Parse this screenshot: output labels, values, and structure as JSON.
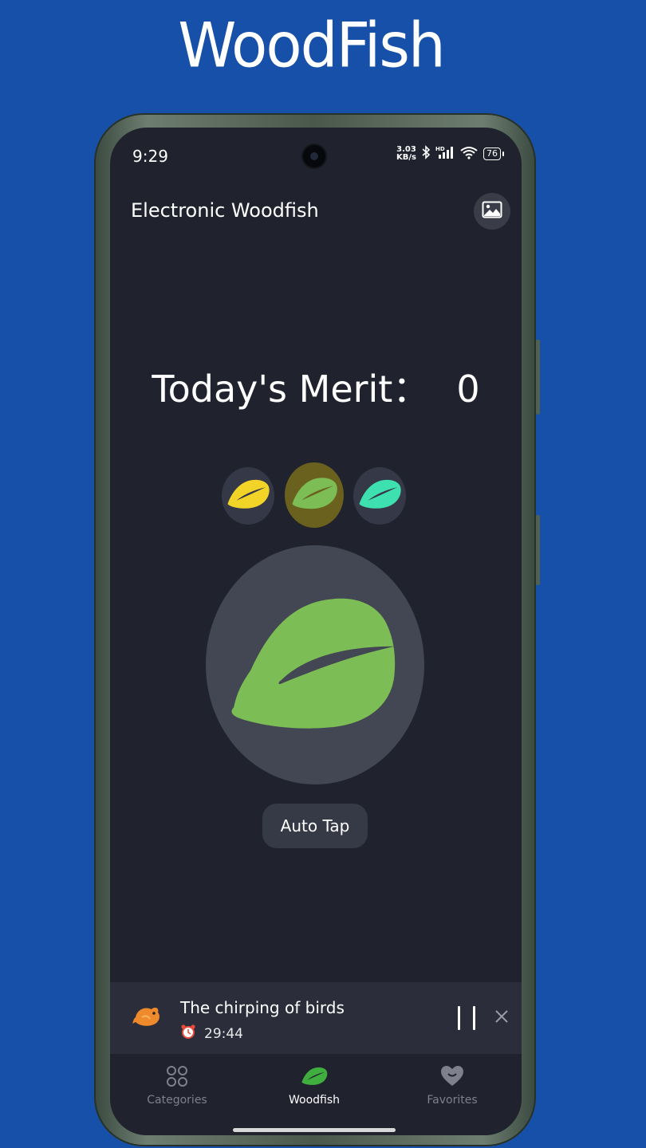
{
  "promo": {
    "title": "WoodFish"
  },
  "status_bar": {
    "time": "9:29",
    "net_speed_value": "3.03",
    "net_speed_unit": "KB/s",
    "hd_label": "HD",
    "battery": "76"
  },
  "header": {
    "title": "Electronic Woodfish"
  },
  "merit": {
    "label": "Today's Merit：",
    "value": "0"
  },
  "woodfish_picker": {
    "options": [
      {
        "color": "#f2d429"
      },
      {
        "color": "#7cbd55",
        "selected": true
      },
      {
        "color": "#3ee0b0"
      }
    ]
  },
  "main_woodfish": {
    "color": "#7cbd55"
  },
  "auto_tap": {
    "label": "Auto Tap"
  },
  "player": {
    "title": "The chirping of birds",
    "timer": "29:44"
  },
  "bottom_nav": {
    "items": [
      {
        "label": "Categories",
        "icon": "categories-icon"
      },
      {
        "label": "Woodfish",
        "icon": "woodfish-icon",
        "active": true
      },
      {
        "label": "Favorites",
        "icon": "heart-icon"
      }
    ]
  },
  "colors": {
    "background": "#1650a8",
    "screen": "#20222e",
    "accent_green": "#7cbd55"
  }
}
